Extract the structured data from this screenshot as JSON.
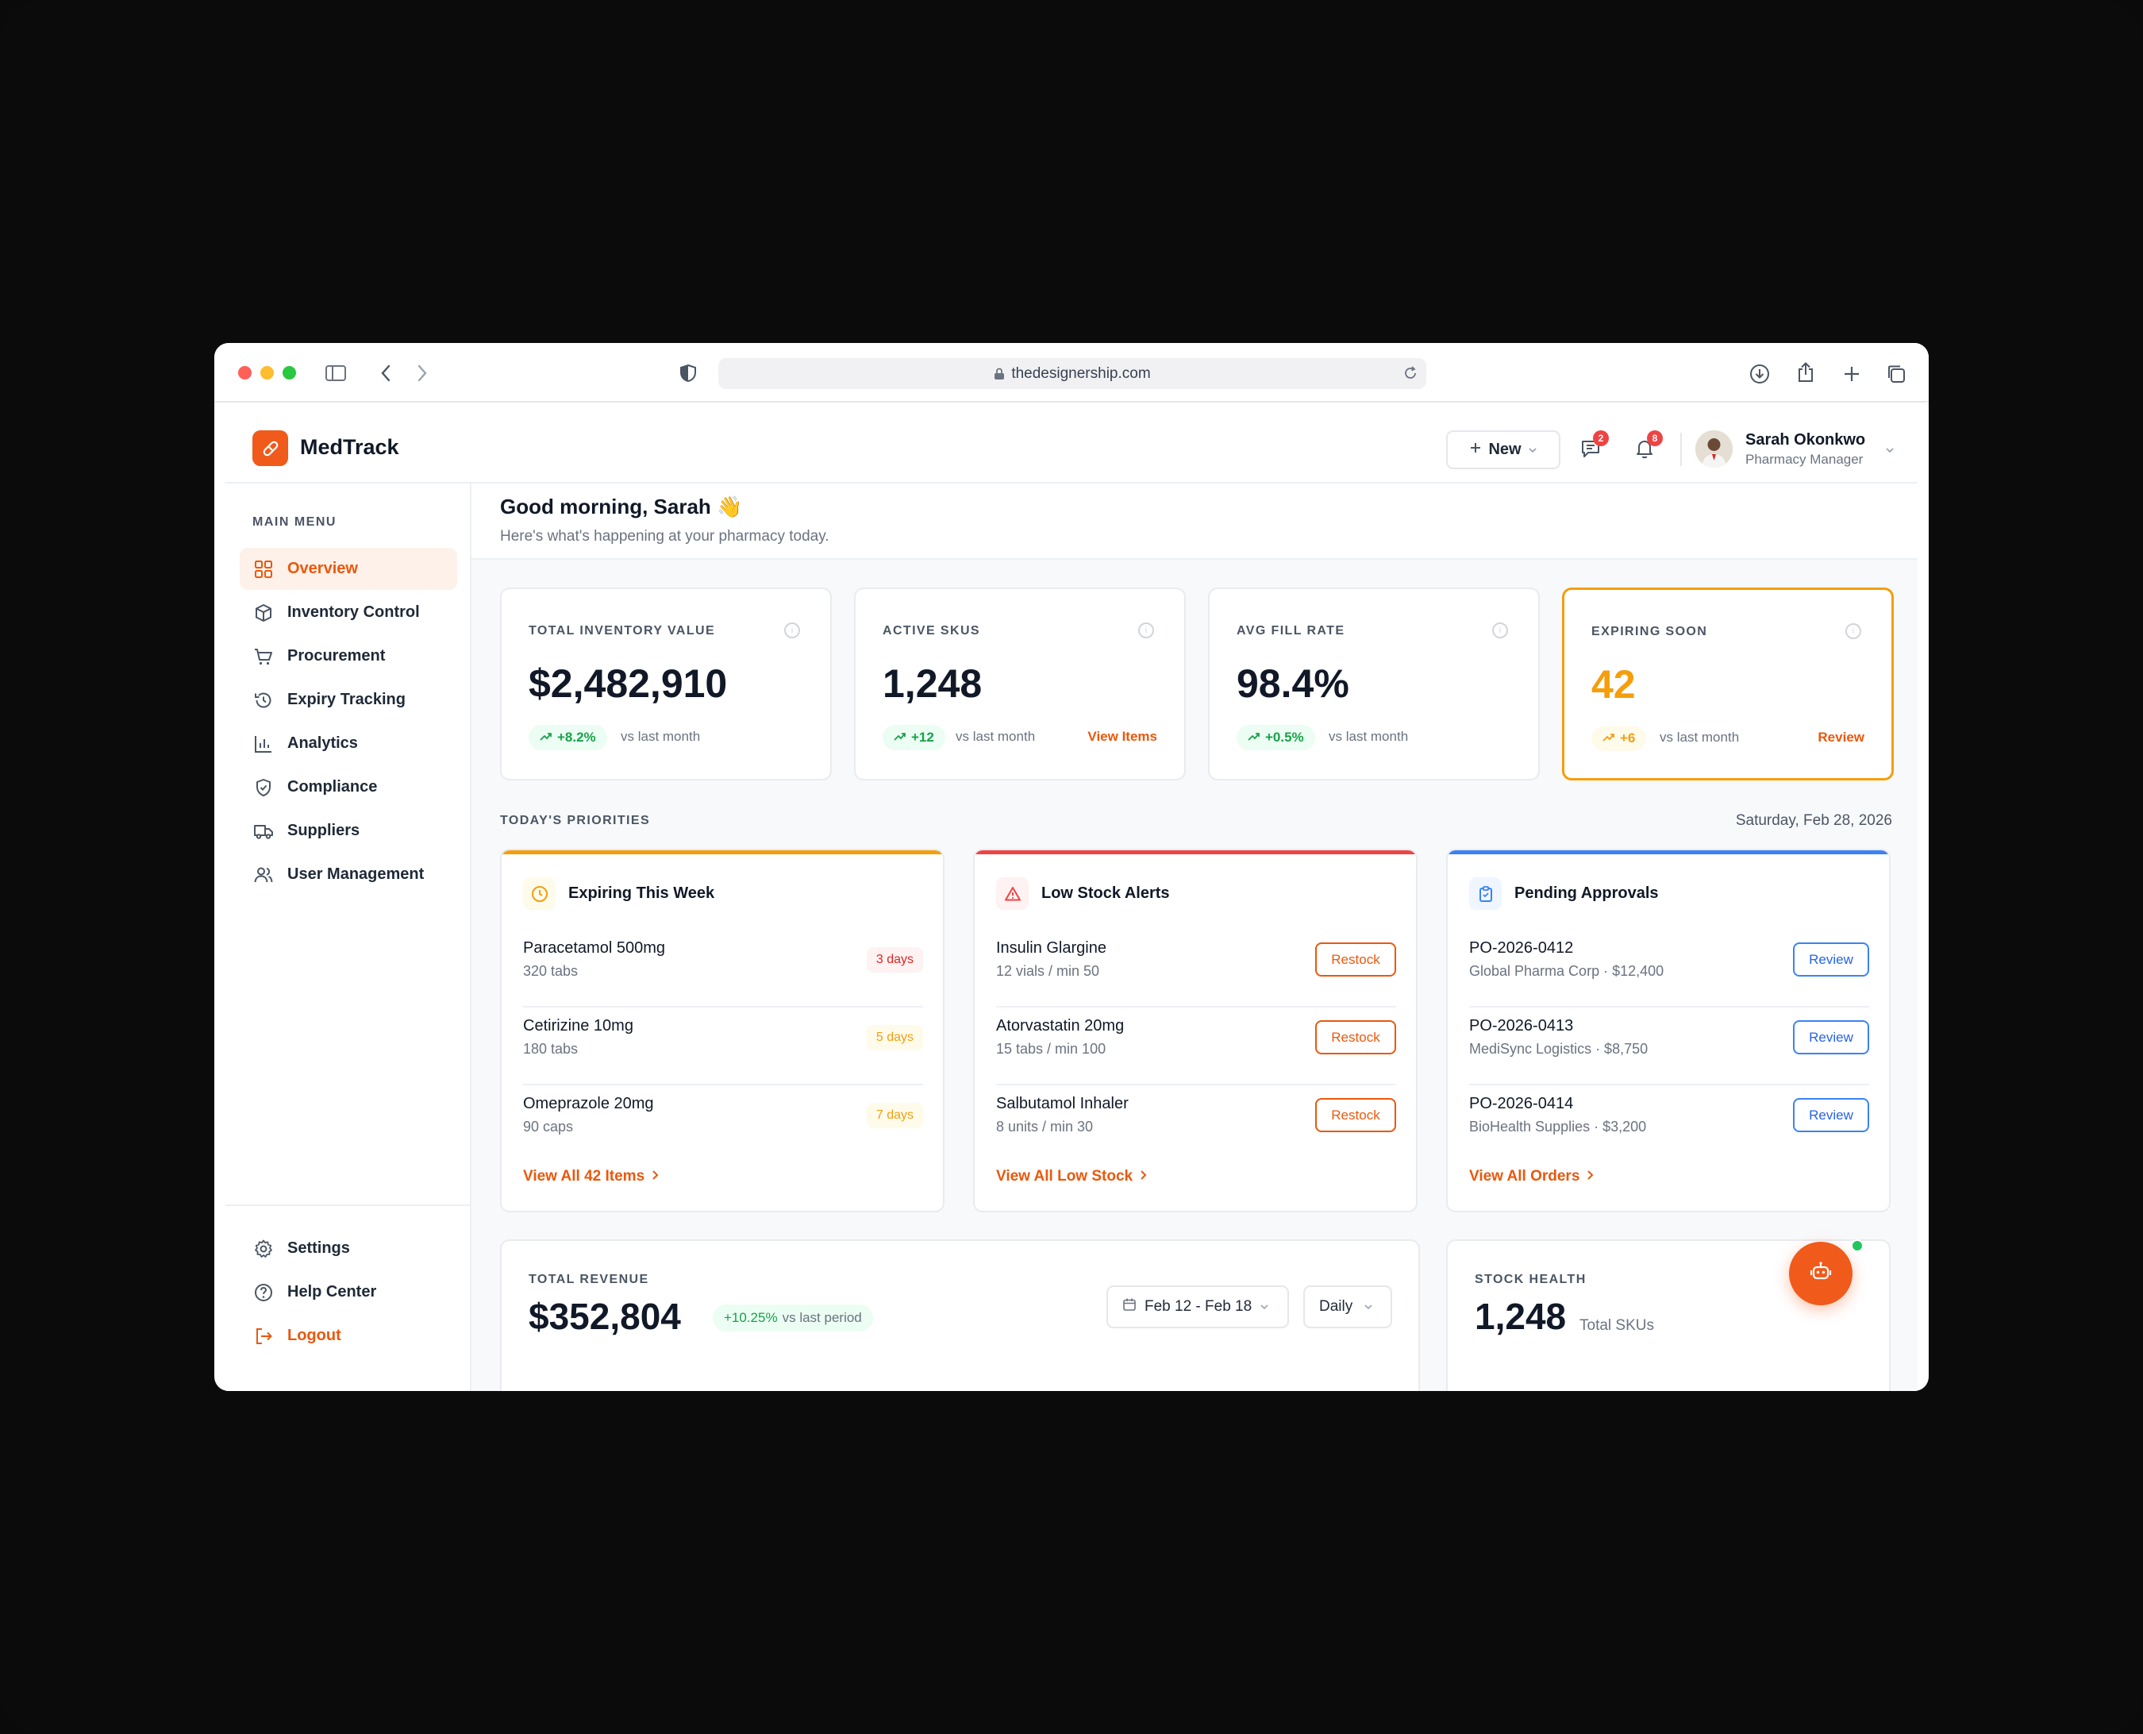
{
  "browser": {
    "url": "thedesignership.com"
  },
  "app": {
    "name": "MedTrack"
  },
  "topbar": {
    "new_label": "New",
    "messages_badge": "2",
    "notifications_badge": "8",
    "user_name": "Sarah Okonkwo",
    "user_role": "Pharmacy Manager"
  },
  "sidebar": {
    "menu_label": "MAIN MENU",
    "items": [
      {
        "label": "Overview",
        "icon": "grid-icon",
        "active": true
      },
      {
        "label": "Inventory Control",
        "icon": "box-icon"
      },
      {
        "label": "Procurement",
        "icon": "cart-icon"
      },
      {
        "label": "Expiry Tracking",
        "icon": "history-icon"
      },
      {
        "label": "Analytics",
        "icon": "bar-chart-icon"
      },
      {
        "label": "Compliance",
        "icon": "shield-check-icon"
      },
      {
        "label": "Suppliers",
        "icon": "truck-icon"
      },
      {
        "label": "User Management",
        "icon": "users-icon"
      }
    ],
    "bottom": [
      {
        "label": "Settings",
        "icon": "gear-icon"
      },
      {
        "label": "Help Center",
        "icon": "help-icon"
      },
      {
        "label": "Logout",
        "icon": "logout-icon"
      }
    ]
  },
  "greeting": {
    "title": "Good morning, Sarah 👋",
    "subtitle": "Here's what's happening at your pharmacy today."
  },
  "stats": [
    {
      "label": "TOTAL INVENTORY VALUE",
      "value": "$2,482,910",
      "change": "+8.2%",
      "vs": "vs last month",
      "link": ""
    },
    {
      "label": "ACTIVE SKUS",
      "value": "1,248",
      "change": "+12",
      "vs": "vs last month",
      "link": "View Items"
    },
    {
      "label": "AVG FILL RATE",
      "value": "98.4%",
      "change": "+0.5%",
      "vs": "vs last month",
      "link": ""
    },
    {
      "label": "EXPIRING SOON",
      "value": "42",
      "change": "+6",
      "vs": "vs last month",
      "link": "Review"
    }
  ],
  "priorities": {
    "label": "TODAY'S PRIORITIES",
    "date": "Saturday, Feb 28, 2026",
    "cards": [
      {
        "title": "Expiring This Week",
        "accent": "#f59e0b",
        "link": "View All 42 Items",
        "rows": [
          {
            "name": "Paracetamol 500mg",
            "sub": "320 tabs",
            "tag": "3 days"
          },
          {
            "name": "Cetirizine 10mg",
            "sub": "180 tabs",
            "tag": "5 days"
          },
          {
            "name": "Omeprazole 20mg",
            "sub": "90 caps",
            "tag": "7 days"
          }
        ]
      },
      {
        "title": "Low Stock Alerts",
        "accent": "#ef4444",
        "link": "View All Low Stock",
        "rows": [
          {
            "name": "Insulin Glargine",
            "sub": "12 vials / min 50",
            "tag": "Restock"
          },
          {
            "name": "Atorvastatin 20mg",
            "sub": "15 tabs / min 100",
            "tag": "Restock"
          },
          {
            "name": "Salbutamol Inhaler",
            "sub": "8 units / min 30",
            "tag": "Restock"
          }
        ]
      },
      {
        "title": "Pending Approvals",
        "accent": "#3b82f6",
        "link": "View All Orders",
        "rows": [
          {
            "name": "PO-2026-0412",
            "sub": "Global Pharma Corp · $12,400",
            "tag": "Review"
          },
          {
            "name": "PO-2026-0413",
            "sub": "MediSync Logistics · $8,750",
            "tag": "Review"
          },
          {
            "name": "PO-2026-0414",
            "sub": "BioHealth Supplies · $3,200",
            "tag": "Review"
          }
        ]
      }
    ]
  },
  "revenue": {
    "label": "TOTAL REVENUE",
    "value": "$352,804",
    "change": "+10.25%",
    "vs": "vs last period",
    "date_range": "Feb 12 - Feb 18",
    "period": "Daily"
  },
  "stock_health": {
    "label": "STOCK HEALTH",
    "value": "1,248",
    "sub": "Total SKUs"
  },
  "colors": {
    "brand": "#f05a1a",
    "success": "#16a34a",
    "warning": "#f59e0b",
    "danger": "#ef4444",
    "info": "#3b82f6"
  }
}
